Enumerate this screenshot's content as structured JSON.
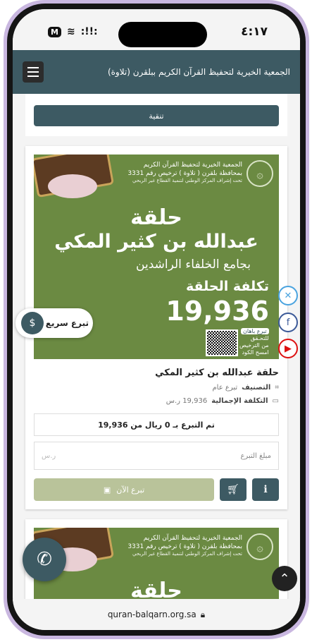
{
  "status_bar": {
    "carrier_badge": "M",
    "signal": ":!!:",
    "time": "٤:١٧"
  },
  "header": {
    "title": "الجمعية الخيرية لتحفيظ القرآن الكريم ببلقرن (تلاوة)",
    "menu_icon": "hamburger-icon"
  },
  "filter": {
    "label": "تنقية"
  },
  "card": {
    "banner": {
      "org_line_1": "الجمعية الخيرية لتحفيظ القرآن الكريم",
      "org_line_2": "بمحافظة بلقرن ( تلاوة ) ترخيص رقم 3331",
      "org_line_3": "تحت إشراف المركز الوطني لتنمية القطاع غير الربحي",
      "halqa": "حلقة",
      "name": "عبدالله بن كثير المكي",
      "mosque": "بجامع الخلفاء الراشدين",
      "cost_label": "تكلفة الحلقة",
      "cost_value": "19,936",
      "qr_chip": "تبرع باهان",
      "qr_note_1": "للتحـقق",
      "qr_note_2": "من الترخيص",
      "qr_note_3": "امسح الكود"
    },
    "quick_donate_label": "تبرع سريع",
    "title": "حلقة عبدالله بن كثير المكي",
    "category_label": "التصنيف",
    "category_value": "تبرع عام",
    "total_label": "التكلفة الإجمالية",
    "total_value": "19,936 ر.س",
    "progress_text": "تم التبرع بـ 0 ريال من 19,936",
    "progress_fraction": 0,
    "amount_placeholder": "مبلغ التبرع",
    "amount_currency": "ر.س",
    "donate_now": "تبرع الآن"
  },
  "banner2": {
    "org_line_1": "الجمعية الخيرية لتحفيظ القرآن الكريم",
    "org_line_2": "بمحافظة بلقرن ( تلاوة ) ترخيص رقم 3331",
    "org_line_3": "تحت إشراف المركز الوطني لتنمية القطاع غير الربحي",
    "halqa": "حلقة"
  },
  "url": "quran-balqarn.org.sa",
  "colors": {
    "primary": "#3d5a63",
    "banner_green": "#6b8a42",
    "donate_disabled": "#b9c39a"
  }
}
